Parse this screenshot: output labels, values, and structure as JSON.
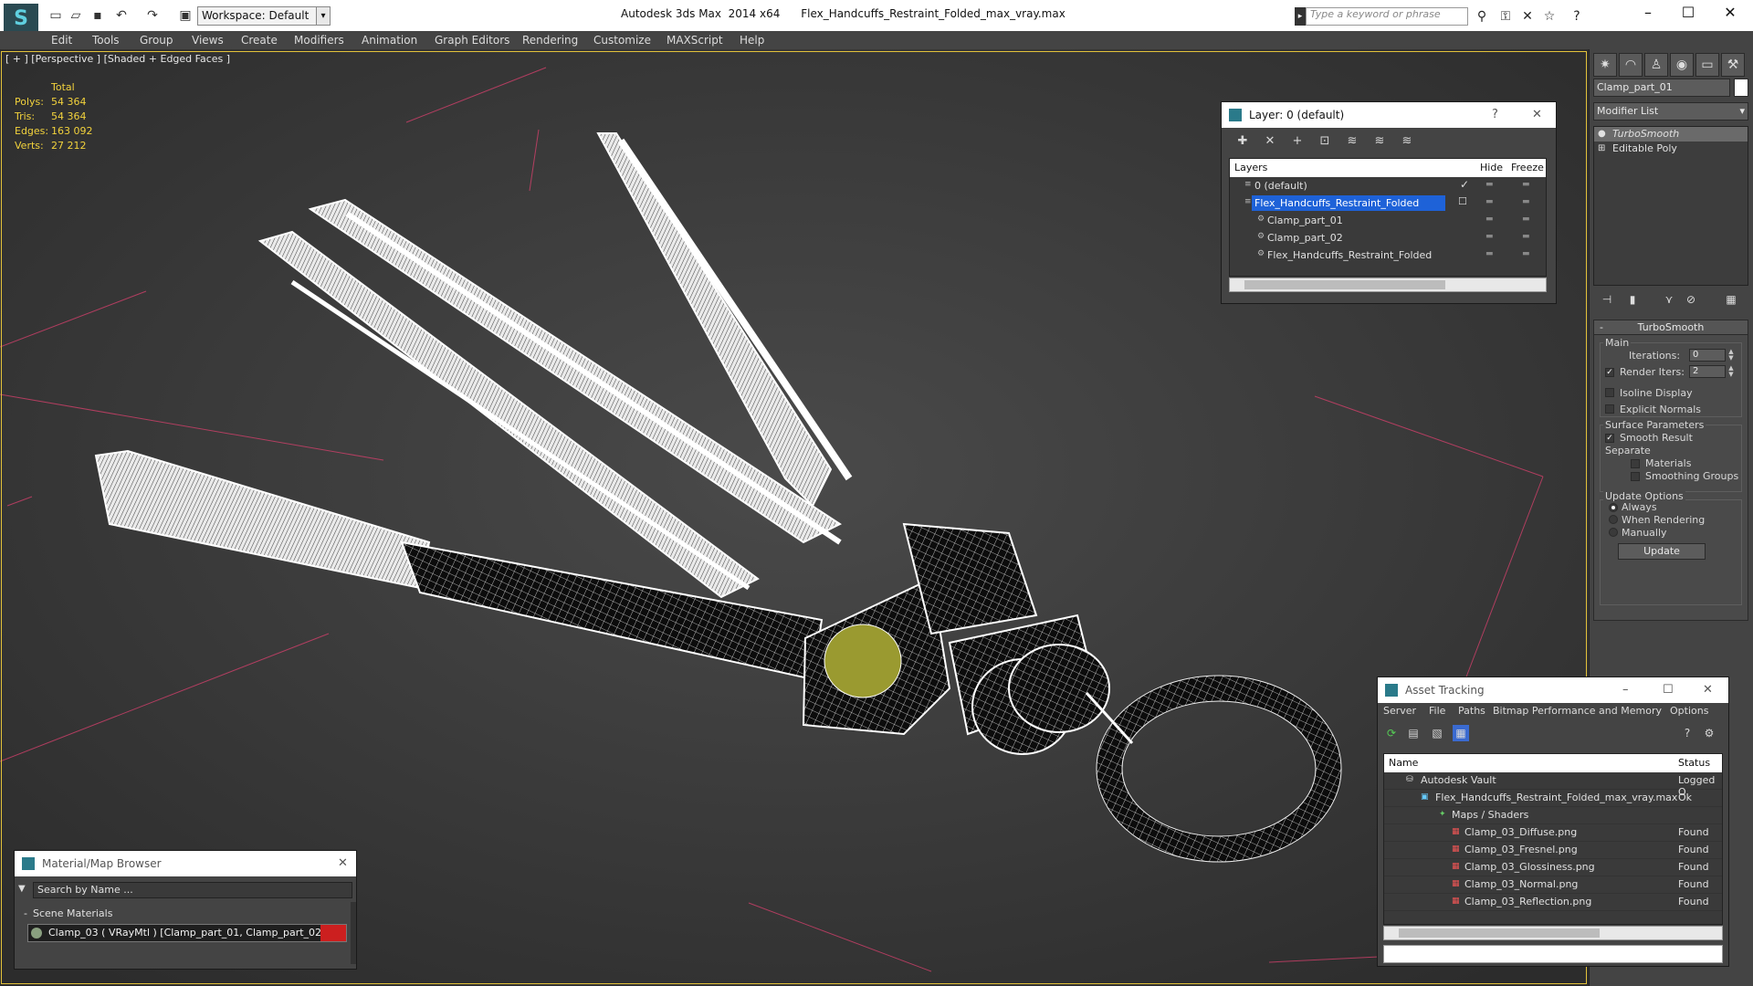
{
  "titlebar": {
    "workspace": "Workspace: Default",
    "app": "Autodesk 3ds Max  2014 x64",
    "file": "Flex_Handcuffs_Restraint_Folded_max_vray.max",
    "search_placeholder": "Type a keyword or phrase"
  },
  "menu": [
    "Edit",
    "Tools",
    "Group",
    "Views",
    "Create",
    "Modifiers",
    "Animation",
    "Graph Editors",
    "Rendering",
    "Customize",
    "MAXScript",
    "Help"
  ],
  "viewport": {
    "label": "[ + ] [Perspective ] [Shaded + Edged Faces ]",
    "stats": {
      "header": "Total",
      "polys_label": "Polys:",
      "polys": "54 364",
      "tris_label": "Tris:",
      "tris": "54 364",
      "edges_label": "Edges:",
      "edges": "163 092",
      "verts_label": "Verts:",
      "verts": "27 212"
    }
  },
  "command_panel": {
    "object_name": "Clamp_part_01",
    "modifier_list": "Modifier List",
    "stack": [
      "TurboSmooth",
      "Editable Poly"
    ],
    "rollout_title": "TurboSmooth",
    "main_label": "Main",
    "iterations_label": "Iterations:",
    "iterations": "0",
    "render_iters_label": "Render Iters:",
    "render_iters": "2",
    "isoline": "Isoline Display",
    "explicit_normals": "Explicit Normals",
    "surface_params": "Surface Parameters",
    "smooth_result": "Smooth Result",
    "separate": "Separate",
    "materials": "Materials",
    "smoothing_groups": "Smoothing Groups",
    "update_options": "Update Options",
    "always": "Always",
    "when_rendering": "When Rendering",
    "manually": "Manually",
    "update": "Update"
  },
  "layer_dialog": {
    "title": "Layer: 0 (default)",
    "help": "?",
    "col_layers": "Layers",
    "col_hide": "Hide",
    "col_freeze": "Freeze",
    "rows": [
      "0 (default)",
      "Flex_Handcuffs_Restraint_Folded",
      "Clamp_part_01",
      "Clamp_part_02",
      "Flex_Handcuffs_Restraint_Folded"
    ]
  },
  "asset_dialog": {
    "title": "Asset Tracking",
    "menu": [
      "Server",
      "File",
      "Paths",
      "Bitmap Performance and Memory",
      "Options"
    ],
    "col_name": "Name",
    "col_status": "Status",
    "rows": [
      {
        "name": "Autodesk Vault",
        "status": "Logged O"
      },
      {
        "name": "Flex_Handcuffs_Restraint_Folded_max_vray.max",
        "status": "Ok"
      },
      {
        "name": "Maps / Shaders",
        "status": ""
      },
      {
        "name": "Clamp_03_Diffuse.png",
        "status": "Found"
      },
      {
        "name": "Clamp_03_Fresnel.png",
        "status": "Found"
      },
      {
        "name": "Clamp_03_Glossiness.png",
        "status": "Found"
      },
      {
        "name": "Clamp_03_Normal.png",
        "status": "Found"
      },
      {
        "name": "Clamp_03_Reflection.png",
        "status": "Found"
      }
    ]
  },
  "material_browser": {
    "title": "Material/Map Browser",
    "search": "Search by Name ...",
    "section": "Scene Materials",
    "item": "Clamp_03  ( VRayMtl )  [Clamp_part_01, Clamp_part_02]"
  }
}
